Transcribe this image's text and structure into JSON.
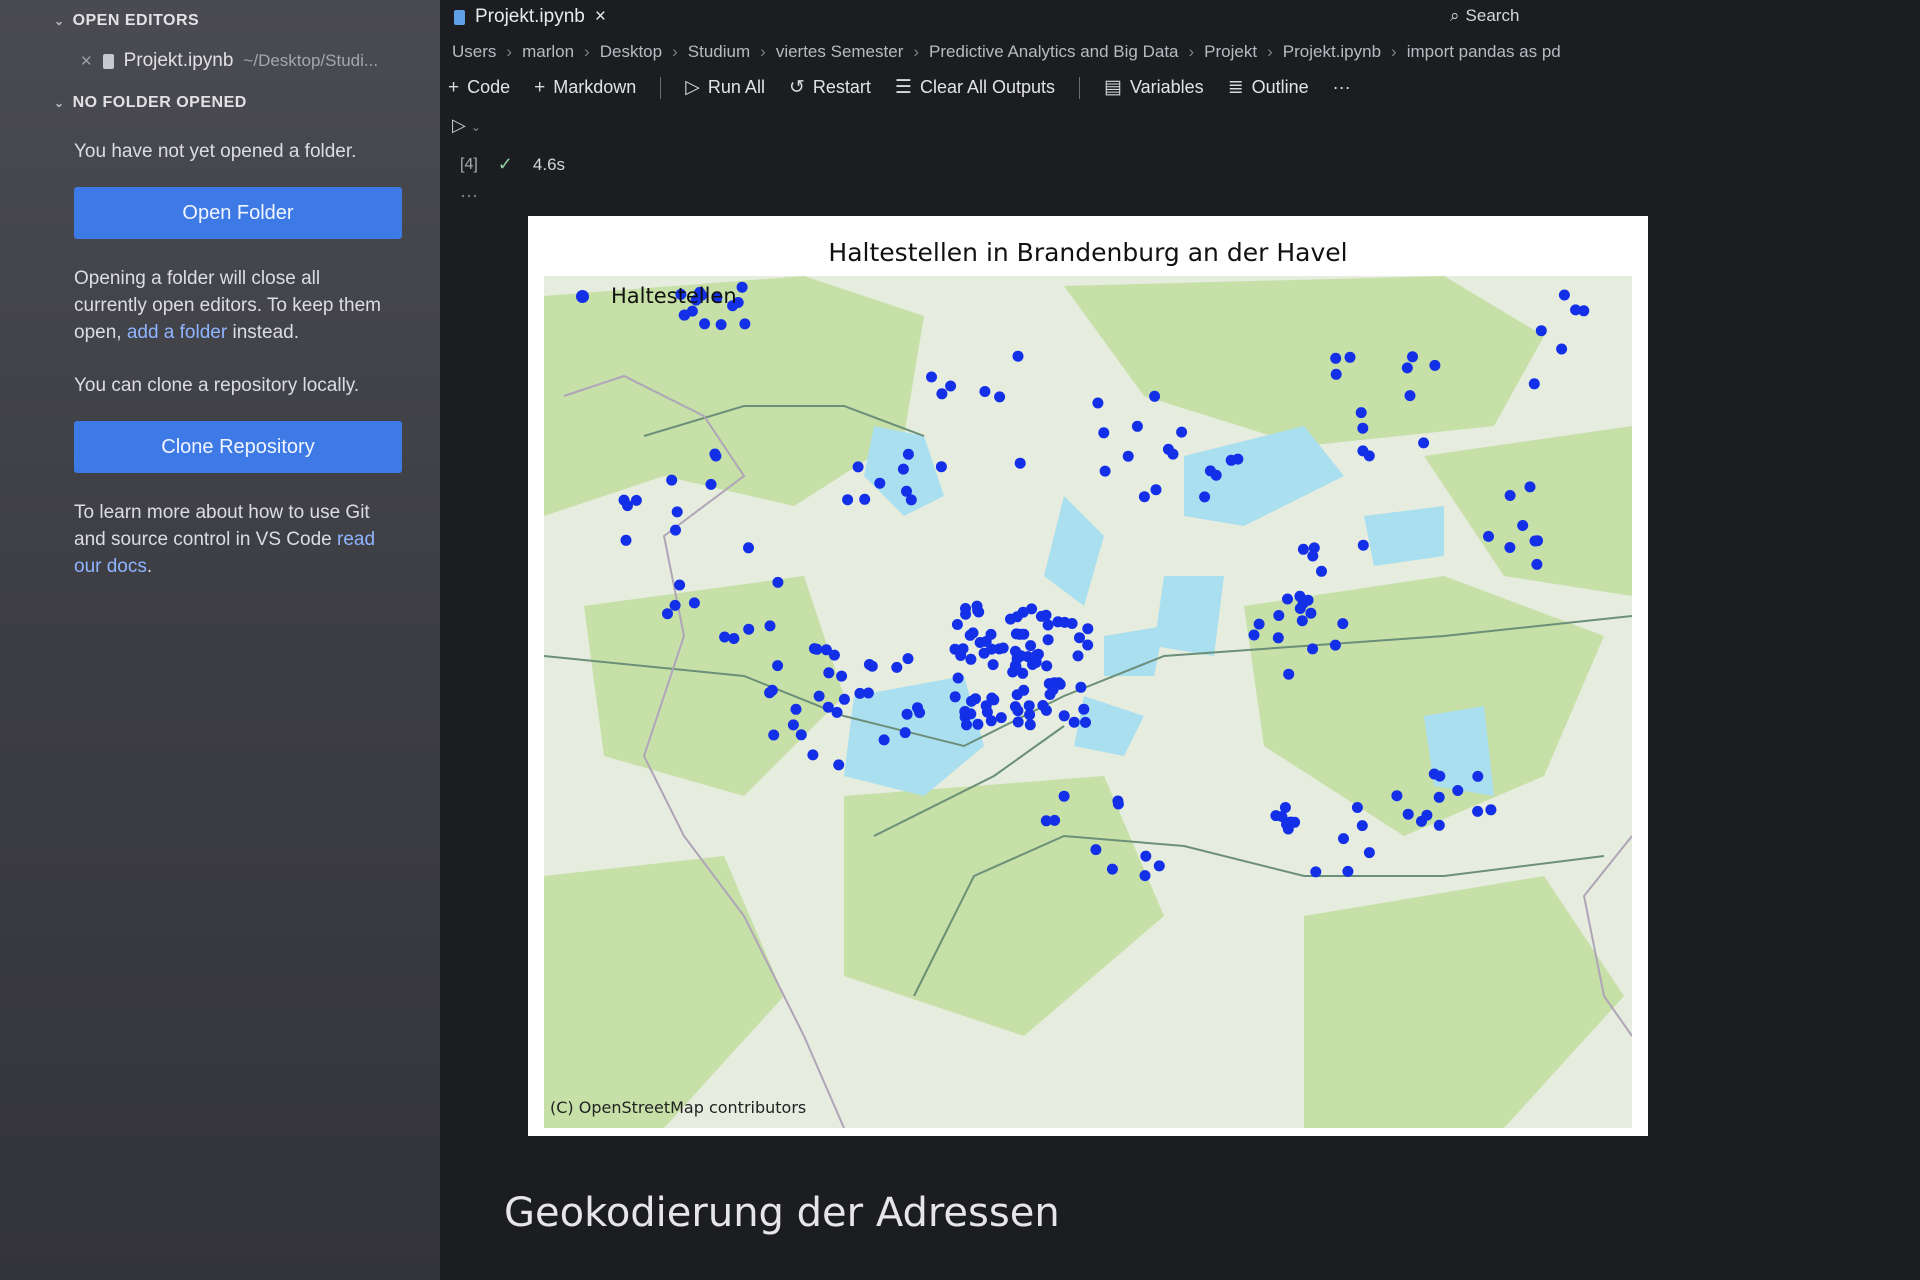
{
  "sidebar": {
    "open_editors_title": "OPEN EDITORS",
    "open_file_name": "Projekt.ipynb",
    "open_file_path": "~/Desktop/Studi...",
    "no_folder_title": "NO FOLDER OPENED",
    "no_folder_text": "You have not yet opened a folder.",
    "open_folder_button": "Open Folder",
    "opening_text": "Opening a folder will close all currently open editors. To keep them open,",
    "add_folder_link": "add a folder",
    "opening_text_end": "instead.",
    "clone_text": "You can clone a repository locally.",
    "clone_button": "Clone Repository",
    "git_text": "To learn more about how to use Git and source control in VS Code",
    "git_link": "read our docs",
    "git_text_end": "."
  },
  "tab": {
    "label": "Projekt.ipynb",
    "close": "×"
  },
  "search": {
    "label": "Search"
  },
  "breadcrumb": [
    "Users",
    "marlon",
    "Desktop",
    "Studium",
    "viertes Semester",
    "Predictive Analytics and Big Data",
    "Projekt",
    "Projekt.ipynb",
    "import pandas as pd"
  ],
  "toolbar": {
    "code": "Code",
    "markdown": "Markdown",
    "run_all": "Run All",
    "restart": "Restart",
    "clear_all_outputs": "Clear All Outputs",
    "variables": "Variables",
    "outline": "Outline",
    "more": "···"
  },
  "cell": {
    "execution_count": "[4]",
    "status_icon": "check-icon",
    "duration": "4.6s",
    "more": "···"
  },
  "figure": {
    "title": "Haltestellen in Brandenburg an der Havel",
    "legend_label": "Haltestellen",
    "attribution": "(C) OpenStreetMap contributors",
    "marker_color": "#1330e8",
    "basemap": "OpenStreetMap"
  },
  "next_section_heading": "Geokodierung der Adressen",
  "colors": {
    "accent_button": "#3d7ae6",
    "editor_bg": "#1b1d21",
    "sidebar_bg": "#404146"
  }
}
